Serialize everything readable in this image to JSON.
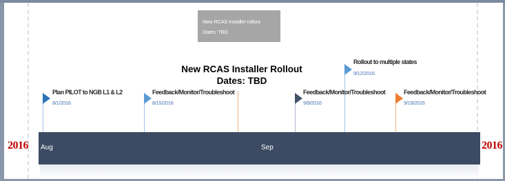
{
  "overlay": {
    "line1": "New RCAS Installer Rollout",
    "line2": "Dates: TBD"
  },
  "gray_box": {
    "line1": "New RCAS Installer rollout",
    "line2": "Dates: TBD"
  },
  "timeline": {
    "year_left": "2016",
    "year_right": "2016",
    "months": [
      "Aug",
      "Sep"
    ]
  },
  "milestones": [
    {
      "title": "Plan PILOT to NGB L1 & L2",
      "date": "8/1/2016",
      "color": "#2e75b6"
    },
    {
      "title": "Feedback/Monitor/Troubleshoot",
      "date": "8/15/2016",
      "color": "#5b9bd5"
    },
    {
      "title": "Feedback/Monitor/Troubleshoot",
      "date": "9/9/2016",
      "color": "#44546a"
    },
    {
      "title": "Rollout to multiple states",
      "date": "9/12/2016",
      "color": "#5b9bd5"
    },
    {
      "title": "Feedback/Monitor/Troubleshoot",
      "date": "9/19/2016",
      "color": "#ed7d31"
    }
  ]
}
